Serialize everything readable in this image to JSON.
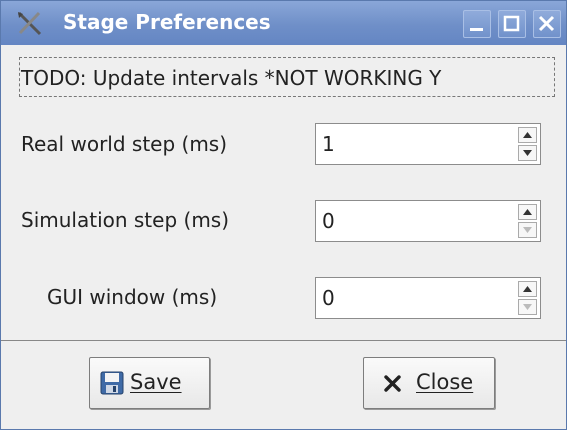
{
  "window": {
    "title": "Stage Preferences",
    "info_text": "TODO: Update intervals *NOT WORKING Y"
  },
  "fields": [
    {
      "label": "Real world step (ms)",
      "value": "1"
    },
    {
      "label": "Simulation step (ms)",
      "value": "0"
    },
    {
      "label": "GUI window (ms)",
      "value": "0"
    }
  ],
  "buttons": {
    "save_label": "Save",
    "close_label": "Close"
  },
  "icons": {
    "app": "tools-icon",
    "save": "floppy-disk-icon",
    "close": "x-icon"
  },
  "colors": {
    "titlebar": "#6f8fc8",
    "background": "#efefef"
  }
}
